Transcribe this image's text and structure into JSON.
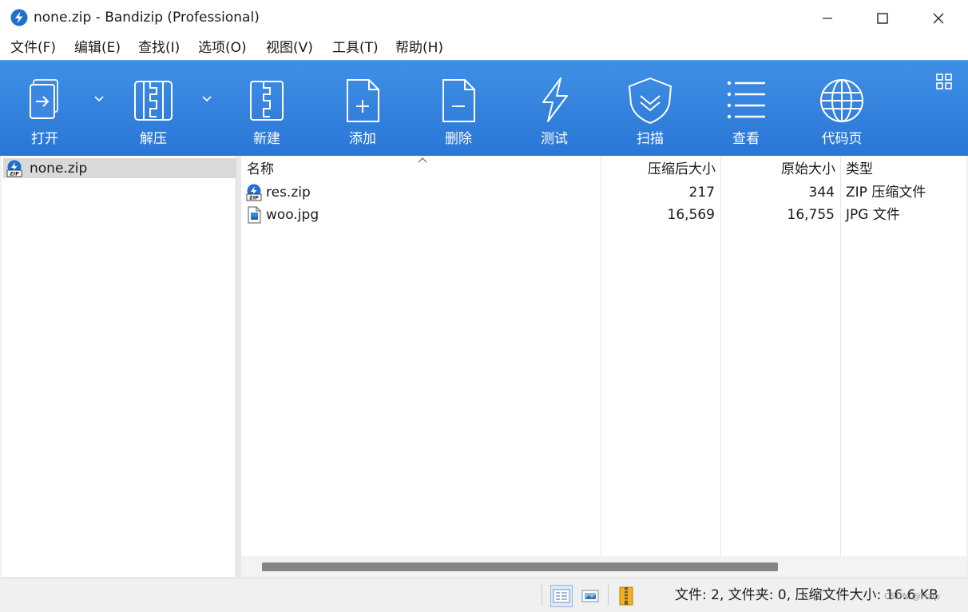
{
  "window": {
    "title": "none.zip - Bandizip (Professional)",
    "app_icon": "bandizip-logo-icon"
  },
  "menu": [
    "文件(F)",
    "编辑(E)",
    "查找(I)",
    "选项(O)",
    "视图(V)",
    "工具(T)",
    "帮助(H)"
  ],
  "toolbar": {
    "buttons": [
      {
        "label": "打开",
        "icon": "open-archive-icon"
      },
      {
        "label": "解压",
        "icon": "extract-icon"
      },
      {
        "label": "新建",
        "icon": "new-archive-icon"
      },
      {
        "label": "添加",
        "icon": "add-file-icon"
      },
      {
        "label": "删除",
        "icon": "delete-file-icon"
      },
      {
        "label": "测试",
        "icon": "test-lightning-icon"
      },
      {
        "label": "扫描",
        "icon": "scan-shield-icon"
      },
      {
        "label": "查看",
        "icon": "view-list-icon"
      },
      {
        "label": "代码页",
        "icon": "codepage-globe-icon"
      }
    ],
    "background": "#3483e0"
  },
  "tree": {
    "items": [
      {
        "label": "none.zip",
        "icon": "zip-archive-icon",
        "selected": true
      }
    ]
  },
  "list": {
    "columns": [
      "名称",
      "压缩后大小",
      "原始大小",
      "类型"
    ],
    "rows": [
      {
        "name": "res.zip",
        "compressed": "217",
        "original": "344",
        "type": "ZIP 压缩文件",
        "icon": "zip-archive-icon"
      },
      {
        "name": "woo.jpg",
        "compressed": "16,569",
        "original": "16,755",
        "type": "JPG 文件",
        "icon": "image-file-icon"
      }
    ],
    "sort_column": "名称"
  },
  "status": {
    "text": "文件: 2, 文件夹: 0, 压缩文件大小: 16.6 KB",
    "watermark": "CSDN @Hzip"
  }
}
